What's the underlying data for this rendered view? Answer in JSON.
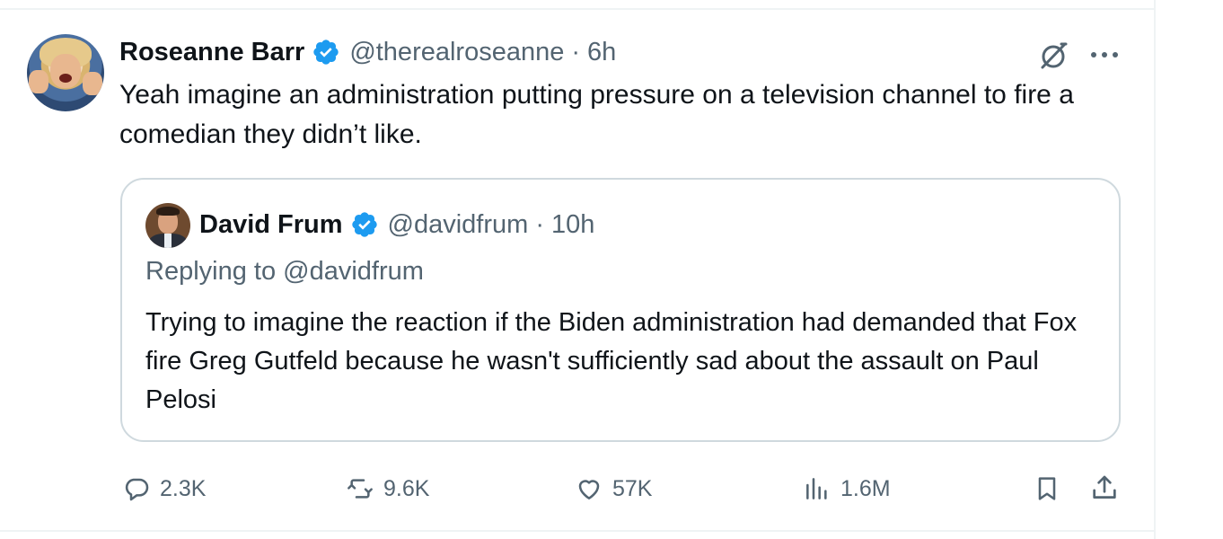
{
  "tweet": {
    "author_name": "Roseanne Barr",
    "handle": "@therealroseanne",
    "separator": "·",
    "time": "6h",
    "text": "Yeah imagine an administration putting pressure on a television channel to fire a comedian they didn’t like."
  },
  "quote": {
    "author_name": "David Frum",
    "handle": "@davidfrum",
    "separator": "·",
    "time": "10h",
    "replying_to": "Replying to @davidfrum",
    "text": "Trying to imagine the reaction if the Biden administration had demanded that Fox fire Greg Gutfeld because he wasn't sufficiently sad about the assault on Paul Pelosi"
  },
  "actions": {
    "replies": "2.3K",
    "reposts": "9.6K",
    "likes": "57K",
    "views": "1.6M"
  },
  "icons": {
    "verified": "verified-badge-icon",
    "grok": "grok-icon",
    "more": "more-icon",
    "reply": "reply-icon",
    "repost": "repost-icon",
    "like": "heart-icon",
    "views": "views-icon",
    "bookmark": "bookmark-icon",
    "share": "share-icon"
  },
  "colors": {
    "text_primary": "#0f1419",
    "text_secondary": "#536471",
    "verified_blue": "#1d9bf0",
    "border": "#cfd9de"
  }
}
